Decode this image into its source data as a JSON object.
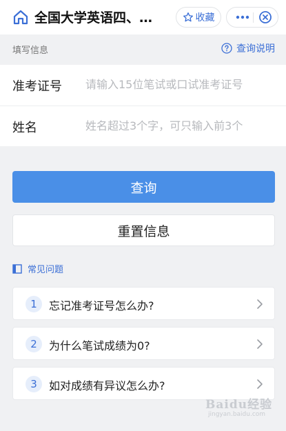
{
  "header": {
    "title": "全国大学英语四、…",
    "favorite_label": "收藏",
    "icons": {
      "home": "home-icon",
      "favorite": "star-icon",
      "more": "more-dots-icon",
      "close": "close-circle-icon"
    }
  },
  "section": {
    "label": "填写信息",
    "help_link": "查询说明"
  },
  "form": {
    "fields": [
      {
        "label": "准考证号",
        "value": "",
        "placeholder": "请输入15位笔试或口试准考证号"
      },
      {
        "label": "姓名",
        "value": "",
        "placeholder": "姓名超过3个字，可只输入前3个"
      }
    ]
  },
  "buttons": {
    "query": "查询",
    "reset": "重置信息"
  },
  "faq": {
    "title": "常见问题",
    "items": [
      {
        "num": "1",
        "text": "忘记准考证号怎么办?"
      },
      {
        "num": "2",
        "text": "为什么笔试成绩为0?"
      },
      {
        "num": "3",
        "text": "如对成绩有异议怎么办?"
      }
    ]
  },
  "watermark": {
    "brand": "Baidu经验",
    "url": "jingyan.baidu.com"
  },
  "colors": {
    "accent": "#3b6fd6",
    "primary_button": "#4a8fe7",
    "background": "#f0f1f3"
  }
}
